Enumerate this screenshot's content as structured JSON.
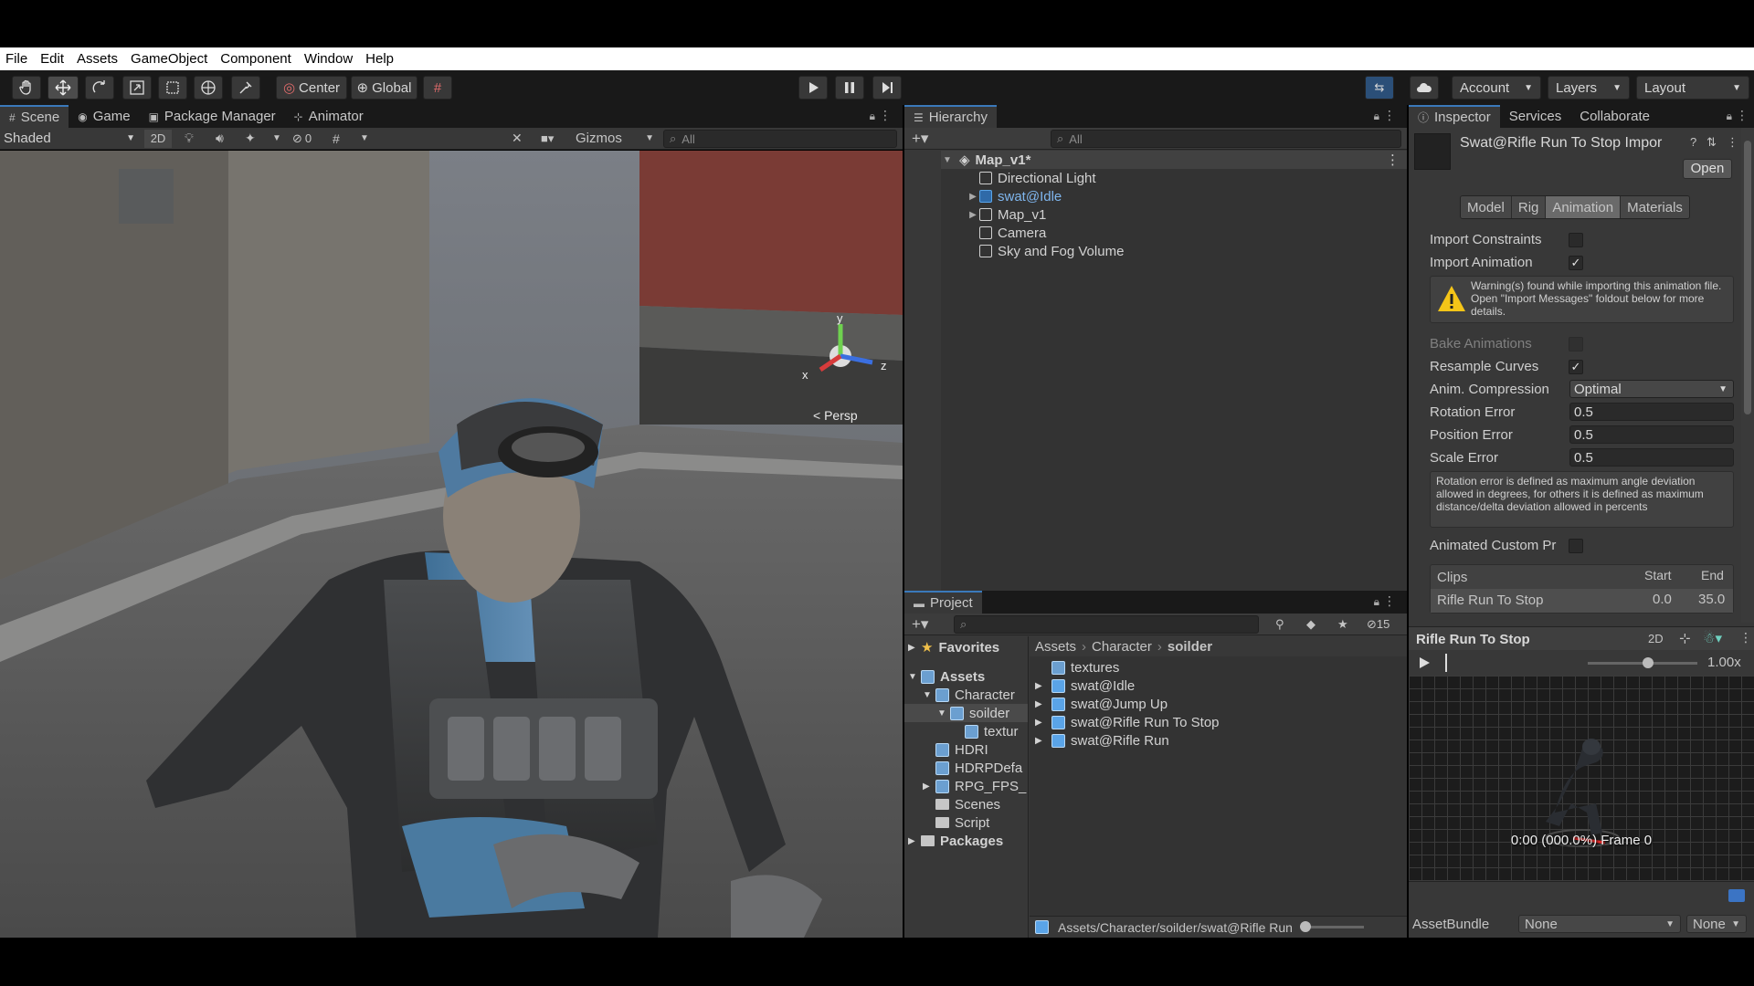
{
  "menu": [
    "File",
    "Edit",
    "Assets",
    "GameObject",
    "Component",
    "Window",
    "Help"
  ],
  "toolbar": {
    "pivot": "Center",
    "space": "Global",
    "account": "Account",
    "layers": "Layers",
    "layout": "Layout"
  },
  "scene_tabs": [
    "Scene",
    "Game",
    "Package Manager",
    "Animator"
  ],
  "scene_bar": {
    "shading": "Shaded",
    "mode2d": "2D",
    "hidden_count": "0",
    "gizmos": "Gizmos",
    "search_placeholder": "All",
    "persp_label": "< Persp",
    "axis_x": "x",
    "axis_y": "y",
    "axis_z": "z"
  },
  "hierarchy": {
    "tab": "Hierarchy",
    "search_placeholder": "All",
    "root": "Map_v1*",
    "items": [
      "Directional Light",
      "swat@Idle",
      "Map_v1",
      "Camera",
      "Sky and Fog Volume"
    ]
  },
  "project": {
    "tab": "Project",
    "hidden_count": "15",
    "favorites": "Favorites",
    "tree": {
      "assets": "Assets",
      "character": "Character",
      "soilder": "soilder",
      "textur": "textur",
      "hdri": "HDRI",
      "hdrpdefa": "HDRPDefa",
      "rpg": "RPG_FPS_",
      "scenes": "Scenes",
      "script": "Script",
      "packages": "Packages"
    },
    "breadcrumb": [
      "Assets",
      "Character",
      "soilder"
    ],
    "files": [
      "textures",
      "swat@Idle",
      "swat@Jump Up",
      "swat@Rifle Run To Stop",
      "swat@Rifle Run"
    ],
    "path": "Assets/Character/soilder/swat@Rifle Run"
  },
  "inspector": {
    "tabs": [
      "Inspector",
      "Services",
      "Collaborate"
    ],
    "title": "Swat@Rifle Run To Stop Impor",
    "open_button": "Open",
    "subtabs": [
      "Model",
      "Rig",
      "Animation",
      "Materials"
    ],
    "import_constraints": "Import Constraints",
    "import_animation": "Import Animation",
    "warning": "Warning(s) found while importing this animation file. Open \"Import Messages\" foldout below for more details.",
    "bake_animations": "Bake Animations",
    "resample_curves": "Resample Curves",
    "anim_compression": "Anim. Compression",
    "anim_compression_value": "Optimal",
    "rotation_error": "Rotation Error",
    "rotation_error_value": "0.5",
    "position_error": "Position Error",
    "position_error_value": "0.5",
    "scale_error": "Scale Error",
    "scale_error_value": "0.5",
    "help_text": "Rotation error is defined as maximum angle deviation allowed in degrees, for others it is defined as maximum distance/delta deviation allowed in percents",
    "animated_custom": "Animated Custom Pr",
    "clips_header": "Clips",
    "start_header": "Start",
    "end_header": "End",
    "clip_name": "Rifle Run To Stop",
    "clip_start": "0.0",
    "clip_end": "35.0",
    "preview_title": "Rifle Run To Stop",
    "preview_2d": "2D",
    "speed": "1.00x",
    "frame_text": "0:00 (000.0%) Frame 0",
    "assetbundle_label": "AssetBundle",
    "assetbundle_value": "None",
    "assetbundle_variant": "None"
  }
}
